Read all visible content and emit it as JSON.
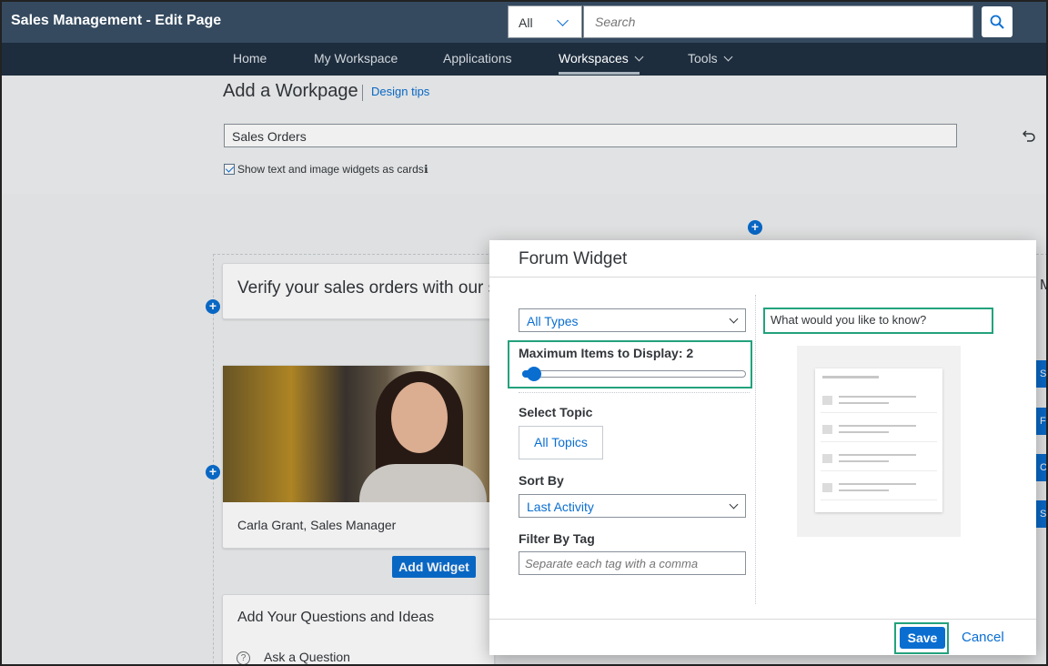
{
  "header": {
    "title": "Sales Management - Edit Page",
    "scope": "All",
    "search_placeholder": "Search"
  },
  "nav": {
    "items": [
      {
        "label": "Home"
      },
      {
        "label": "My Workspace"
      },
      {
        "label": "Applications"
      },
      {
        "label": "Workspaces"
      },
      {
        "label": "Tools"
      }
    ]
  },
  "page": {
    "title": "Add a Workpage",
    "design_tips": "Design tips",
    "workpage_name": "Sales Orders",
    "show_cards_label": "Show text and image widgets as cards",
    "info_glyph": "ℹ",
    "verify_text": "Verify your sales orders with our s",
    "caption": "Carla Grant, Sales Manager",
    "add_widget": "Add Widget",
    "questions_title": "Add Your Questions and Ideas",
    "ask_question": "Ask a Question",
    "right_edge_letters": [
      "S",
      "F",
      "C",
      "S"
    ],
    "right_edge_title": "M"
  },
  "dialog": {
    "title": "Forum Widget",
    "type_value": "All Types",
    "max_items_label": "Maximum Items to Display: 2",
    "max_items": 2,
    "select_topic_label": "Select Topic",
    "topic_button": "All Topics",
    "sort_by_label": "Sort By",
    "sort_value": "Last Activity",
    "filter_label": "Filter By Tag",
    "filter_placeholder": "Separate each tag with a comma",
    "question_text": "What would you like to know?",
    "save": "Save",
    "cancel": "Cancel"
  },
  "colors": {
    "accent": "#0a6ed1",
    "header_bg": "#354a5f",
    "nav_bg": "#1d2d3e",
    "highlight": "#23a27c"
  }
}
